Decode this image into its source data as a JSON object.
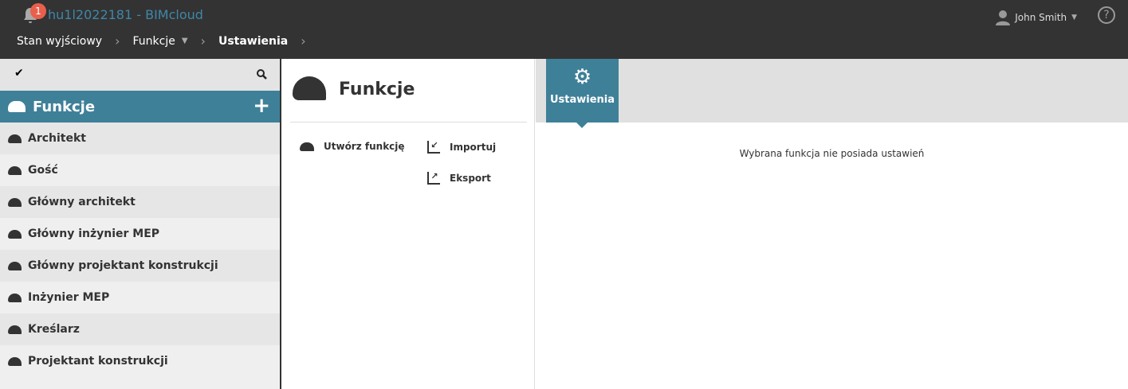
{
  "header": {
    "notification_count": "1",
    "app_title": "hu1l2022181 - BIMcloud",
    "user_name": "John Smith",
    "help": "?"
  },
  "breadcrumb": [
    "Stan wyjściowy",
    "Funkcje",
    "Ustawienia"
  ],
  "sidebar": {
    "title": "Funkcje",
    "items": [
      "Architekt",
      "Gość",
      "Główny architekt",
      "Główny inżynier MEP",
      "Główny projektant konstrukcji",
      "Inżynier MEP",
      "Kreślarz",
      "Projektant konstrukcji"
    ]
  },
  "middle": {
    "title": "Funkcje",
    "create": "Utwórz funkcję",
    "import": "Importuj",
    "export": "Eksport"
  },
  "settings": {
    "tab": "Ustawienia",
    "message": "Wybrana funkcja nie posiada ustawień"
  },
  "colors": {
    "accent": "#3f8099",
    "topbar": "#333333",
    "badge": "#e8604c"
  }
}
